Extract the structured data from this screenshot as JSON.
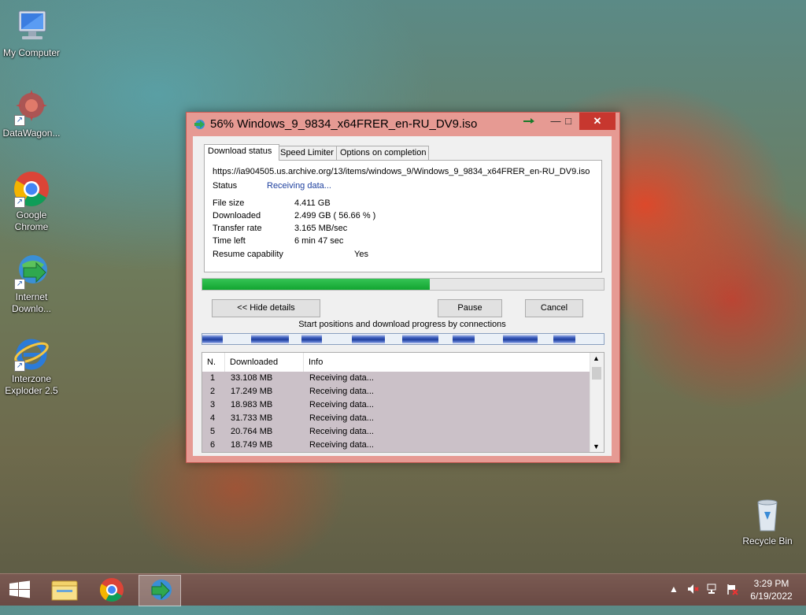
{
  "desktop": {
    "icons": [
      {
        "label": "My Computer"
      },
      {
        "label": "DataWagon..."
      },
      {
        "label": "Google Chrome"
      },
      {
        "label": "Internet Downlo..."
      },
      {
        "label": "Interzone Exploder 2.5"
      },
      {
        "label": "Recycle Bin"
      }
    ]
  },
  "window": {
    "title": "56% Windows_9_9834_x64FRER_en-RU_DV9.iso",
    "minimize_glyph": "—",
    "maximize_glyph": "□",
    "close_glyph": "✕",
    "tabs": [
      {
        "label": "Download status",
        "active": true
      },
      {
        "label": "Speed Limiter",
        "active": false
      },
      {
        "label": "Options on completion",
        "active": false
      }
    ],
    "url": "https://ia904505.us.archive.org/13/items/windows_9/Windows_9_9834_x64FRER_en-RU_DV9.iso",
    "status": {
      "label": "Status",
      "value": "Receiving data..."
    },
    "details": [
      {
        "label": "File size",
        "value": "4.411  GB"
      },
      {
        "label": "Downloaded",
        "value": "2.499  GB  ( 56.66 % )"
      },
      {
        "label": "Transfer rate",
        "value": "3.165  MB/sec"
      },
      {
        "label": "Time left",
        "value": "6 min 47 sec"
      },
      {
        "label": "Resume capability",
        "value": "Yes"
      }
    ],
    "progress_percent": 56.66,
    "buttons": {
      "hide_details": "<< Hide details",
      "pause": "Pause",
      "cancel": "Cancel"
    },
    "connections_label": "Start positions and download progress by connections",
    "connections_table": {
      "headers": [
        "N.",
        "Downloaded",
        "Info"
      ],
      "rows": [
        [
          "1",
          "33.108  MB",
          "Receiving data..."
        ],
        [
          "2",
          "17.249  MB",
          "Receiving data..."
        ],
        [
          "3",
          "18.983  MB",
          "Receiving data..."
        ],
        [
          "4",
          "31.733  MB",
          "Receiving data..."
        ],
        [
          "5",
          "20.764  MB",
          "Receiving data..."
        ],
        [
          "6",
          "18.749  MB",
          "Receiving data..."
        ]
      ]
    }
  },
  "taskbar": {
    "items": [
      {
        "icon": "windows-start-icon"
      },
      {
        "icon": "file-explorer-icon"
      },
      {
        "icon": "chrome-icon"
      },
      {
        "icon": "internet-download-manager-icon",
        "active": true
      }
    ],
    "tray_up_arrow": "▲",
    "clock_time": "3:29 PM",
    "clock_date": "6/19/2022"
  },
  "colors": {
    "window_frame": "#e69a93",
    "close_button": "#c7372f",
    "progress_green": "#12a530",
    "status_blue": "#1d3f9e",
    "connection_blue": "#1f3f9f"
  }
}
